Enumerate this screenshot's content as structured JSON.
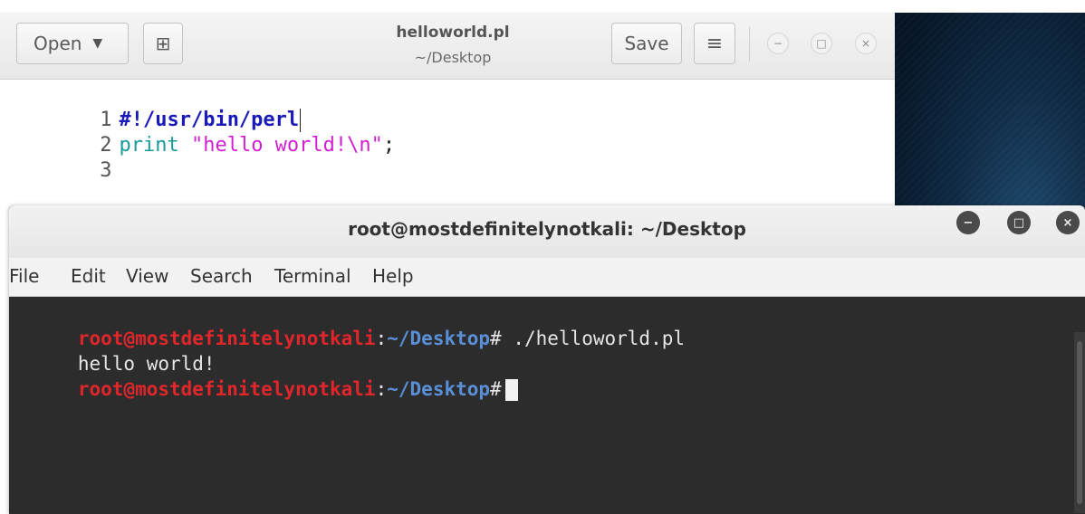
{
  "gedit": {
    "open_label": "Open",
    "open_caret": "▼",
    "new_doc_icon": "⊞",
    "title": "helloworld.pl",
    "subtitle": "~/Desktop",
    "save_label": "Save",
    "menu_icon": "≡",
    "min_icon": "−",
    "max_icon": "□",
    "close_icon": "×",
    "lines": [
      {
        "num": "1",
        "shebang": "#!/usr/bin/perl"
      },
      {
        "num": "2",
        "func": "print",
        "space": " ",
        "str": "\"hello world!\\n\"",
        "end": ";"
      },
      {
        "num": "3"
      }
    ]
  },
  "terminal": {
    "title": "root@mostdefinitelynotkali: ~/Desktop",
    "min_icon": "−",
    "max_icon": "□",
    "close_icon": "×",
    "menu": [
      "File",
      "Edit",
      "View",
      "Search",
      "Terminal",
      "Help"
    ],
    "prompt_user": "root@mostdefinitelynotkali",
    "prompt_colon": ":",
    "prompt_path": "~/Desktop",
    "prompt_hash": "#",
    "command_1": " ./helloworld.pl",
    "output_1": "hello world!"
  }
}
